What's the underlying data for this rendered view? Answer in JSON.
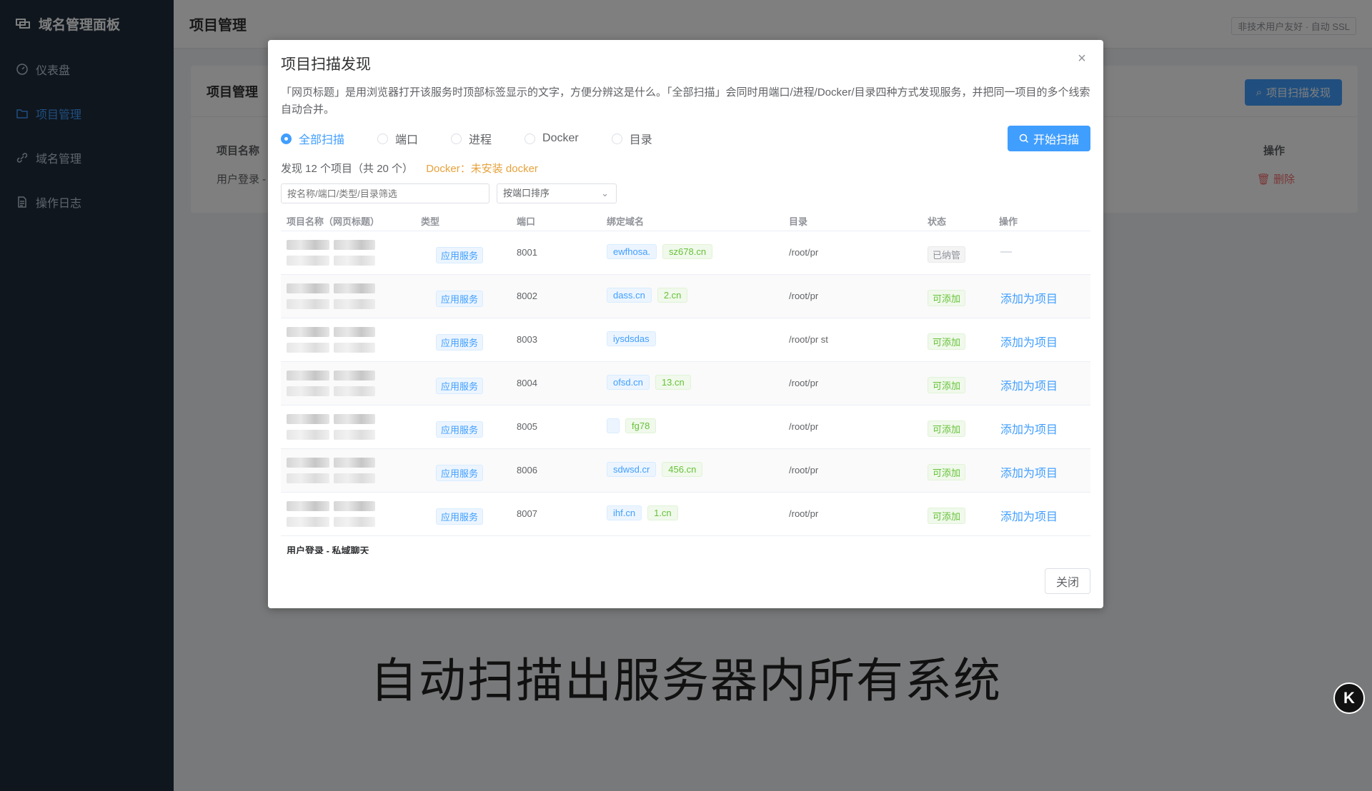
{
  "sidebar": {
    "brand": "域名管理面板",
    "items": [
      {
        "label": "仪表盘",
        "icon": "dashboard-icon"
      },
      {
        "label": "项目管理",
        "icon": "folder-icon",
        "active": true
      },
      {
        "label": "域名管理",
        "icon": "link-icon"
      },
      {
        "label": "操作日志",
        "icon": "document-icon"
      }
    ]
  },
  "topbar": {
    "title": "项目管理",
    "tag": "非技术用户友好 · 自动 SSL"
  },
  "card": {
    "title": "项目管理",
    "scan_button": "项目扫描发现",
    "col_name": "项目名称",
    "col_op": "操作",
    "row_name": "用户登录 -",
    "row_delete": "删除"
  },
  "dialog": {
    "title": "项目扫描发现",
    "description": "「网页标题」是用浏览器打开该服务时顶部标签显示的文字，方便分辨这是什么。「全部扫描」会同时用端口/进程/Docker/目录四种方式发现服务，并把同一项目的多个线索自动合并。",
    "radios": [
      "全部扫描",
      "端口",
      "进程",
      "Docker",
      "目录"
    ],
    "selected_radio": "全部扫描",
    "start_button": "开始扫描",
    "summary": "发现 12 个项目（共 20 个）",
    "docker_status": "Docker：未安装 docker",
    "filter_placeholder": "按名称/端口/类型/目录筛选",
    "sort_value": "按端口排序",
    "headers": [
      "项目名称（网页标题）",
      "类型",
      "端口",
      "绑定域名",
      "目录",
      "状态",
      "操作"
    ],
    "rows": [
      {
        "type": "应用服务",
        "port": "8001",
        "domains": [
          "ewfhosa.",
          "sz678.cn"
        ],
        "dir": "/root/pr",
        "status": "已纳管",
        "op": "—"
      },
      {
        "type": "应用服务",
        "port": "8002",
        "domains": [
          "dass.cn",
          "2.cn"
        ],
        "dir": "/root/pr",
        "status": "可添加",
        "op": "添加为项目"
      },
      {
        "type": "应用服务",
        "port": "8003",
        "domains": [
          "iysdsdas"
        ],
        "dir": "/root/pr  st",
        "status": "可添加",
        "op": "添加为项目"
      },
      {
        "type": "应用服务",
        "port": "8004",
        "domains": [
          "ofsd.cn",
          "13.cn"
        ],
        "dir": "/root/pr",
        "status": "可添加",
        "op": "添加为项目"
      },
      {
        "type": "应用服务",
        "port": "8005",
        "domains": [
          "",
          "fg78"
        ],
        "dir": "/root/pr",
        "status": "可添加",
        "op": "添加为项目"
      },
      {
        "type": "应用服务",
        "port": "8006",
        "domains": [
          "sdwsd.cr",
          "456.cn"
        ],
        "dir": "/root/pr",
        "status": "可添加",
        "op": "添加为项目"
      },
      {
        "type": "应用服务",
        "port": "8007",
        "domains": [
          "ihf.cn",
          "1.cn"
        ],
        "dir": "/root/pr",
        "status": "可添加",
        "op": "添加为项目"
      }
    ],
    "partial_row_name": "用户登录 - 私域聊天",
    "close_button": "关闭"
  },
  "caption": "自动扫描出服务器内所有系统",
  "badge": "K"
}
